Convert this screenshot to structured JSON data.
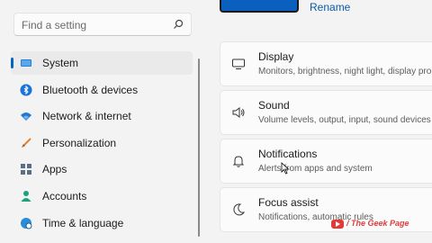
{
  "search": {
    "placeholder": "Find a setting"
  },
  "sidebar": {
    "items": [
      {
        "label": "System",
        "icon": "system-icon",
        "active": true
      },
      {
        "label": "Bluetooth & devices",
        "icon": "bluetooth-icon"
      },
      {
        "label": "Network & internet",
        "icon": "wifi-icon"
      },
      {
        "label": "Personalization",
        "icon": "brush-icon"
      },
      {
        "label": "Apps",
        "icon": "apps-icon"
      },
      {
        "label": "Accounts",
        "icon": "person-icon"
      },
      {
        "label": "Time & language",
        "icon": "globe-clock-icon"
      }
    ]
  },
  "header": {
    "rename_label": "Rename"
  },
  "cards": [
    {
      "title": "Display",
      "subtitle": "Monitors, brightness, night light, display pro",
      "icon": "display-icon"
    },
    {
      "title": "Sound",
      "subtitle": "Volume levels, output, input, sound devices",
      "icon": "speaker-icon"
    },
    {
      "title": "Notifications",
      "subtitle": "Alerts from apps and system",
      "icon": "bell-icon"
    },
    {
      "title": "Focus assist",
      "subtitle": "Notifications, automatic rules",
      "icon": "moon-icon"
    }
  ],
  "watermark": {
    "text": "/ The Geek Page"
  },
  "colors": {
    "accent": "#0067c0",
    "background": "#f3f3f3",
    "card": "#fbfbfb"
  }
}
